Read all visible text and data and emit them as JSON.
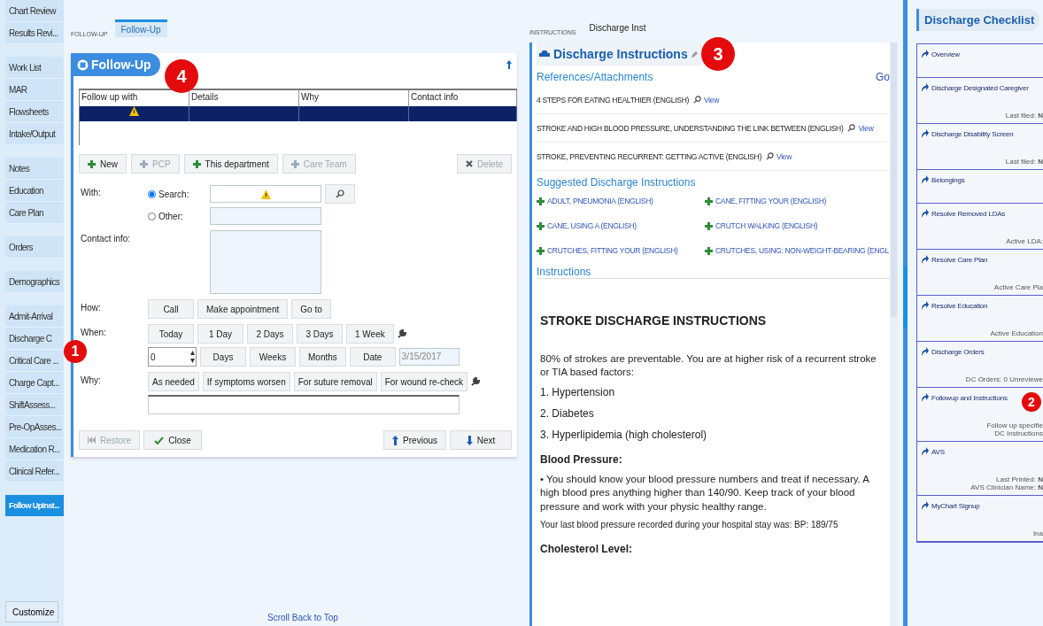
{
  "sidebar": {
    "groups": [
      {
        "items": [
          {
            "label": "Chart Review",
            "selected": false
          },
          {
            "label": "Results Revi...",
            "selected": false
          }
        ]
      },
      {
        "items": [
          {
            "label": "Work List",
            "selected": false
          },
          {
            "label": "MAR",
            "selected": false
          },
          {
            "label": "Flowsheets",
            "selected": false
          },
          {
            "label": "Intake/Output",
            "selected": false
          }
        ]
      },
      {
        "items": [
          {
            "label": "Notes",
            "selected": false
          },
          {
            "label": "Education",
            "selected": false
          },
          {
            "label": "Care Plan",
            "selected": false
          }
        ]
      },
      {
        "items": [
          {
            "label": "Orders",
            "selected": false
          }
        ]
      },
      {
        "items": [
          {
            "label": "Demographics",
            "selected": false
          }
        ]
      },
      {
        "items": [
          {
            "label": "Admit-Arrival",
            "selected": false
          },
          {
            "label": "Discharge C",
            "selected": false
          },
          {
            "label": "Critical Care ...",
            "selected": false
          },
          {
            "label": "Charge Capt...",
            "selected": false
          },
          {
            "label": "ShiftAssess...",
            "selected": false
          },
          {
            "label": "Pre-OpAsses...",
            "selected": false
          },
          {
            "label": "Medication R...",
            "selected": false
          },
          {
            "label": "Clinical Refer...",
            "selected": false
          }
        ]
      },
      {
        "items": [
          {
            "label": "Follow UpInst...",
            "selected": true
          }
        ]
      }
    ],
    "customize": "Customize"
  },
  "follow_up": {
    "breadcrumb": "FOLLOW-UP",
    "tabs": [
      {
        "label": "Follow-Up",
        "selected": true
      }
    ],
    "title": "Follow-Up",
    "table": {
      "columns": [
        "Follow up with",
        "Details",
        "Why",
        "Contact info"
      ],
      "rows": [
        {
          "selected": true,
          "warning": true
        }
      ]
    },
    "toolbar": [
      {
        "label": "New",
        "disabled": false,
        "kind": "add"
      },
      {
        "label": "PCP",
        "disabled": true,
        "kind": "add"
      },
      {
        "label": "This department",
        "disabled": false,
        "kind": "add"
      },
      {
        "label": "Care Team",
        "disabled": true,
        "kind": "add"
      },
      {
        "label": "Delete",
        "disabled": true,
        "kind": "delete"
      }
    ],
    "with_label": "With:",
    "radios": [
      {
        "label": "Search:",
        "selected": true
      },
      {
        "label": "Other:",
        "selected": false
      }
    ],
    "contact_label": "Contact info:",
    "how_label": "How:",
    "how": [
      "Call",
      "Make appointment",
      "Go to"
    ],
    "when_label": "When:",
    "when": [
      "Today",
      "1 Day",
      "2 Days",
      "3 Days",
      "1 Week"
    ],
    "count_value": "0",
    "units": [
      "Days",
      "Weeks",
      "Months",
      "Date"
    ],
    "date_value": "3/15/2017",
    "why_label": "Why:",
    "why": [
      "As needed",
      "If symptoms worsen",
      "For suture removal",
      "For wound re-check"
    ],
    "footer": [
      {
        "label": "Restore",
        "kind": "restore",
        "disabled": true
      },
      {
        "label": "Close",
        "kind": "close",
        "disabled": false
      },
      {
        "label": "Previous",
        "kind": "previous",
        "disabled": false
      },
      {
        "label": "Next",
        "kind": "next",
        "disabled": false
      }
    ],
    "scroll_top": "Scroll Back to Top"
  },
  "instructions": {
    "breadcrumb": "INSTRUCTIONS",
    "tab_label": "Discharge Inst",
    "title": "Discharge Instructions",
    "references_title": "References/Attachments",
    "go": "Go",
    "references": [
      {
        "title": "4 STEPS FOR EATING HEALTHIER (ENGLISH)",
        "link": "View"
      },
      {
        "title": "STROKE AND HIGH BLOOD PRESSURE, UNDERSTANDING THE LINK BETWEEN (ENGLISH)",
        "link": "View"
      },
      {
        "title": "STROKE, PREVENTING RECURRENT: GETTING ACTIVE (ENGLISH)",
        "link": "View"
      }
    ],
    "suggested_title": "Suggested Discharge Instructions",
    "suggested": [
      "ADULT, PNEUMONIA (ENGLISH)",
      "CANE, FITTING YOUR (ENGLISH)",
      "CANE, USING A (ENGLISH)",
      "CRUTCH WALKING (ENGLISH)",
      "CRUTCHES, FITTING YOUR (ENGLISH)",
      "CRUTCHES, USING: NON-WEIGHT-BEARING (ENGL"
    ],
    "instructions_title": "Instructions",
    "document": [
      {
        "kind": "heading",
        "text": "STROKE DISCHARGE INSTRUCTIONS"
      },
      {
        "kind": "paragraph",
        "text": "80% of strokes are preventable. You are at higher risk of a recurrent stroke or TIA based factors:"
      },
      {
        "kind": "list",
        "items": [
          "Hypertension",
          "Diabetes",
          "Hyperlipidemia (high cholesterol)"
        ],
        "numbers": [
          "1.",
          "2.",
          "3."
        ]
      },
      {
        "kind": "subheading",
        "text": "Blood Pressure:"
      },
      {
        "kind": "paragraph",
        "text": "• You should know your blood pressure numbers and treat if necessary. A high blood pres anything higher than 140/90. Keep track of your blood pressure and work with your physic healthy range."
      },
      {
        "kind": "small",
        "text": "Your last blood pressure recorded during your hospital stay was: BP: 189/75"
      },
      {
        "kind": "subheading",
        "text": "Cholesterol Level:"
      }
    ]
  },
  "checklist": {
    "title": "Discharge Checklist",
    "items": [
      {
        "title": "Overview"
      },
      {
        "title": "Discharge Designated Caregiver",
        "notes": [
          "Last filed: **N**"
        ]
      },
      {
        "title": "Discharge Disability Screen",
        "notes": [
          "Last filed: **N**"
        ]
      },
      {
        "title": "Belongings"
      },
      {
        "title": "Resolve Removed LDAs",
        "notes": [
          "Active LDA:"
        ]
      },
      {
        "title": "Resolve Care Plan",
        "notes": [
          "Active Care Pla"
        ]
      },
      {
        "title": "Resolve Education",
        "notes": [
          "Active Education"
        ]
      },
      {
        "title": "Discharge Orders",
        "notes": [
          "DC Orders: 0 Unreviewe"
        ]
      },
      {
        "title": "Followup and Instructions",
        "notes": [
          "Follow up specifie",
          "DC Instructions"
        ]
      },
      {
        "title": "AVS",
        "notes": [
          "Last Printed: **N**",
          "AVS Clinician Name: **N**"
        ]
      },
      {
        "title": "MyChart Signup",
        "notes": [
          "Ina"
        ]
      }
    ]
  },
  "callouts": [
    "1",
    "2",
    "3",
    "4"
  ]
}
